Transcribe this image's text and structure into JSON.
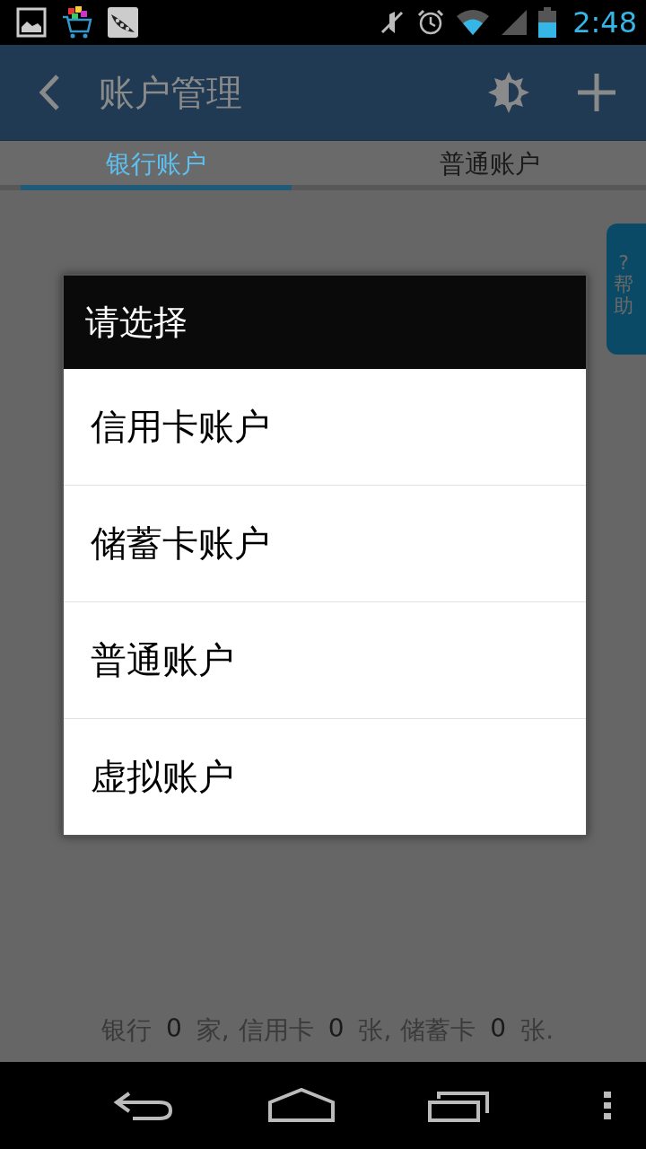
{
  "status_bar": {
    "time": "2:48"
  },
  "action_bar": {
    "title": "账户管理"
  },
  "tabs": [
    {
      "label": "银行账户",
      "selected": true
    },
    {
      "label": "普通账户",
      "selected": false
    }
  ],
  "help_tab": {
    "mark": "?",
    "label": "帮助"
  },
  "summary": [
    {
      "kind": "label",
      "text": "银行"
    },
    {
      "kind": "count",
      "text": "0"
    },
    {
      "kind": "label",
      "text": "家,"
    },
    {
      "kind": "label",
      "text": "信用卡"
    },
    {
      "kind": "count",
      "text": "0"
    },
    {
      "kind": "label",
      "text": "张,"
    },
    {
      "kind": "label",
      "text": "储蓄卡"
    },
    {
      "kind": "count",
      "text": "0"
    },
    {
      "kind": "label",
      "text": "张."
    }
  ],
  "dialog": {
    "title": "请选择",
    "options": [
      "信用卡账户",
      "储蓄卡账户",
      "普通账户",
      "虚拟账户"
    ]
  }
}
